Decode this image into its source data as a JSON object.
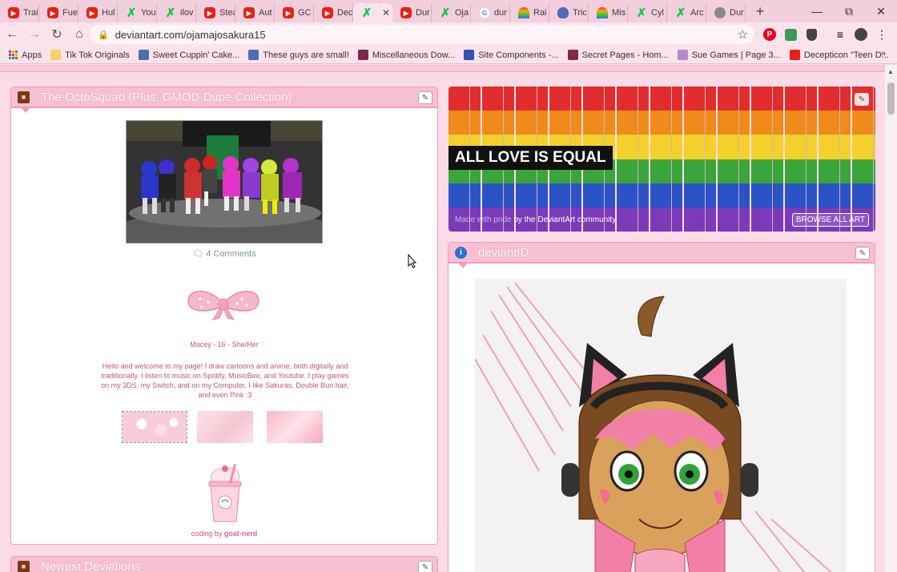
{
  "tabs": [
    {
      "label": "Trai",
      "icon": "youtube"
    },
    {
      "label": "Fue",
      "icon": "youtube"
    },
    {
      "label": "Hul",
      "icon": "youtube"
    },
    {
      "label": "You",
      "icon": "deviantart"
    },
    {
      "label": "ilov",
      "icon": "deviantart"
    },
    {
      "label": "Stea",
      "icon": "youtube"
    },
    {
      "label": "Aut",
      "icon": "youtube"
    },
    {
      "label": "GC",
      "icon": "youtube"
    },
    {
      "label": "Dec",
      "icon": "youtube"
    },
    {
      "label": "",
      "icon": "deviantart",
      "active": true
    },
    {
      "label": "Dur",
      "icon": "youtube"
    },
    {
      "label": "Oja",
      "icon": "deviantart"
    },
    {
      "label": "dur",
      "icon": "google"
    },
    {
      "label": "Rai",
      "icon": "rainbow"
    },
    {
      "label": "Tric",
      "icon": "shield"
    },
    {
      "label": "Mis",
      "icon": "rainbow"
    },
    {
      "label": "Cyl",
      "icon": "deviantart"
    },
    {
      "label": "Arc",
      "icon": "deviantart"
    },
    {
      "label": "Dur",
      "icon": "globe"
    }
  ],
  "browser": {
    "url": "deviantart.com/ojamajosakura15",
    "apps_label": "Apps"
  },
  "bookmarks": [
    {
      "label": "Tik Tok Originals",
      "color": "#f5d26a"
    },
    {
      "label": "Sweet Cuppin' Cake...",
      "color": "#4a6fb0"
    },
    {
      "label": "These guys are small!",
      "color": "#4a6fb0"
    },
    {
      "label": "Miscellaneous Dow...",
      "color": "#7a2a4a"
    },
    {
      "label": "Site Components -...",
      "color": "#3355aa"
    },
    {
      "label": "Secret Pages - Hom...",
      "color": "#7a2a4a"
    },
    {
      "label": "Sue Games | Page 3...",
      "color": "#b88ac8"
    },
    {
      "label": "Decepticon \"Teen D...",
      "color": "#e62117"
    }
  ],
  "left_panel": {
    "title": "The OctoSquad (Plus, GMOD Dupe Collection)",
    "comments": "4 Comments",
    "profile_line": "Macey - 16 - She/Her",
    "bio": "Hello and welcome to my page! I draw cartoons and anime, both digitally and traditionally. I listen to music on Spotify, MusicBee, and Youtube. I play games on my 3DS, my Switch, and on my Computer. I like Sakuras, Double Bun hair, and even Pink :3",
    "coding_by": "coding by",
    "coding_author": "goat-nerd"
  },
  "newest_panel": {
    "title": "Newest Deviations"
  },
  "banner": {
    "headline": "ALL LOVE IS EQUAL",
    "made_with": "Made with pride",
    "community": "by the DeviantArt community",
    "button": "BROWSE ALL ART",
    "stripes": [
      "#e12d2d",
      "#f08a1a",
      "#f3d12a",
      "#3aa53a",
      "#2c52c8",
      "#7b3ab8"
    ]
  },
  "deviantid_panel": {
    "title": "deviantID"
  }
}
